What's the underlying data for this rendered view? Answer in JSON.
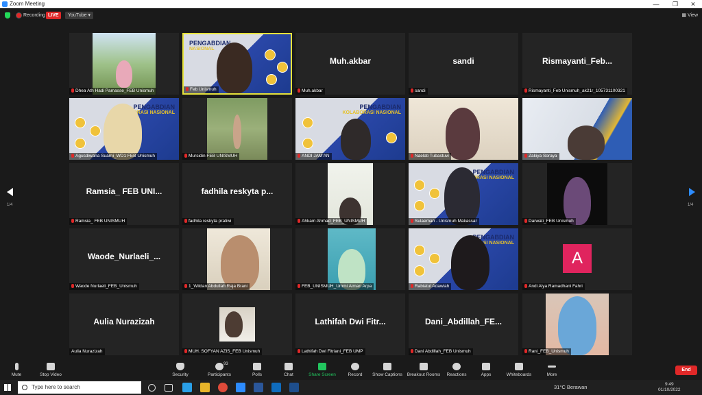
{
  "window": {
    "title": "Zoom Meeting",
    "minimize": "—",
    "restore": "❐",
    "close": "✕"
  },
  "topbar": {
    "recording": "Recording",
    "live": "LIVE",
    "stream": "YouTube ▾",
    "view": "▦ View"
  },
  "pagination": {
    "left": "1/4",
    "right": "1/4"
  },
  "tiles": [
    {
      "label": "Dhea Ath Hadi Pamasse_FEB Unismuh",
      "kind": "video-girl"
    },
    {
      "label": "Feb Unismuh",
      "kind": "poster-man",
      "poster_title": "PENGABDIAN",
      "poster_sub": "NASIONAL"
    },
    {
      "label": "Muh.akbar",
      "display": "Muh.akbar",
      "kind": "name"
    },
    {
      "label": "sandi",
      "display": "sandi",
      "kind": "name"
    },
    {
      "label": "Rismayanti_Feb Unismuh_ak21r_105731100321",
      "display": "Rismayanti_Feb...",
      "kind": "name"
    },
    {
      "label": "Agusdiwana Suarni_WD1 FEB Unismuh",
      "kind": "poster-woman",
      "poster_title": "PENGABDIAN",
      "poster_sub": "KOLABORASI NASIONAL"
    },
    {
      "label": "Mursidin FEB UNISMUH",
      "kind": "video-garden"
    },
    {
      "label": "ANDI JAM'AN",
      "kind": "poster-man",
      "poster_title": "PENGABDIAN",
      "poster_sub": "KOLABORASI NASIONAL"
    },
    {
      "label": "Naelati Tubastuvi",
      "kind": "video-room"
    },
    {
      "label": "Zakiya Soraya",
      "kind": "video-room"
    },
    {
      "label": "Ramsia_ FEB UNISMUH",
      "display": "Ramsia_ FEB UNI...",
      "kind": "name"
    },
    {
      "label": "fadhila reskyta pratiwi",
      "display": "fadhila reskyta p...",
      "kind": "name"
    },
    {
      "label": "Ahkam Ahmad_FEB_UNISMUH",
      "kind": "video-room"
    },
    {
      "label": "Sulaeman - Unismuh Makassar",
      "kind": "poster-man",
      "poster_title": "PENGABDIAN",
      "poster_sub": "ORASI NASIONAL"
    },
    {
      "label": "Darwati_FEB Unismuh",
      "kind": "video-dark"
    },
    {
      "label": "Waode Nurlaeli_FEB_Unismuh",
      "display": "Waode_Nurlaeli_...",
      "kind": "name"
    },
    {
      "label": "1_Wildan Abdullah Raja Brani",
      "kind": "video-room"
    },
    {
      "label": "FEB_UNISMUH_Ummi Aiman Arpa",
      "kind": "video-room"
    },
    {
      "label": "Rabiatul Adawiah",
      "kind": "poster-woman",
      "poster_title": "PENGABDIAN",
      "poster_sub": "ORASI NASIONAL"
    },
    {
      "label": "Andi Alya Ramadhani Fahri",
      "kind": "avatar",
      "avatar": "A"
    },
    {
      "label": "Aulia Nurazizah",
      "display": "Aulia Nurazizah",
      "kind": "name"
    },
    {
      "label": "MUH. SOFYAN AZIS_FEB Unismuh",
      "kind": "video-small"
    },
    {
      "label": "Lathifah Dwi Fitriani_FEB UMP",
      "display": "Lathifah Dwi Fitr...",
      "kind": "name"
    },
    {
      "label": "Dani Abdillah_FEB Unismuh",
      "display": "Dani_Abdillah_FE...",
      "kind": "name"
    },
    {
      "label": "Rani_FEB_Unismuh",
      "kind": "video-blue"
    }
  ],
  "toolbar": {
    "mute": "Mute",
    "stop_video": "Stop Video",
    "security": "Security",
    "participants": "Participants",
    "participants_count": "93",
    "polls": "Polls",
    "chat": "Chat",
    "share_screen": "Share Screen",
    "record": "Record",
    "show_captions": "Show Captions",
    "breakout_rooms": "Breakout Rooms",
    "reactions": "Reactions",
    "apps": "Apps",
    "whiteboards": "Whiteboards",
    "more": "More",
    "end": "End"
  },
  "taskbar": {
    "search_placeholder": "Type here to search",
    "weather": "31°C  Berawan",
    "time": "9:49",
    "date": "01/10/2022"
  }
}
